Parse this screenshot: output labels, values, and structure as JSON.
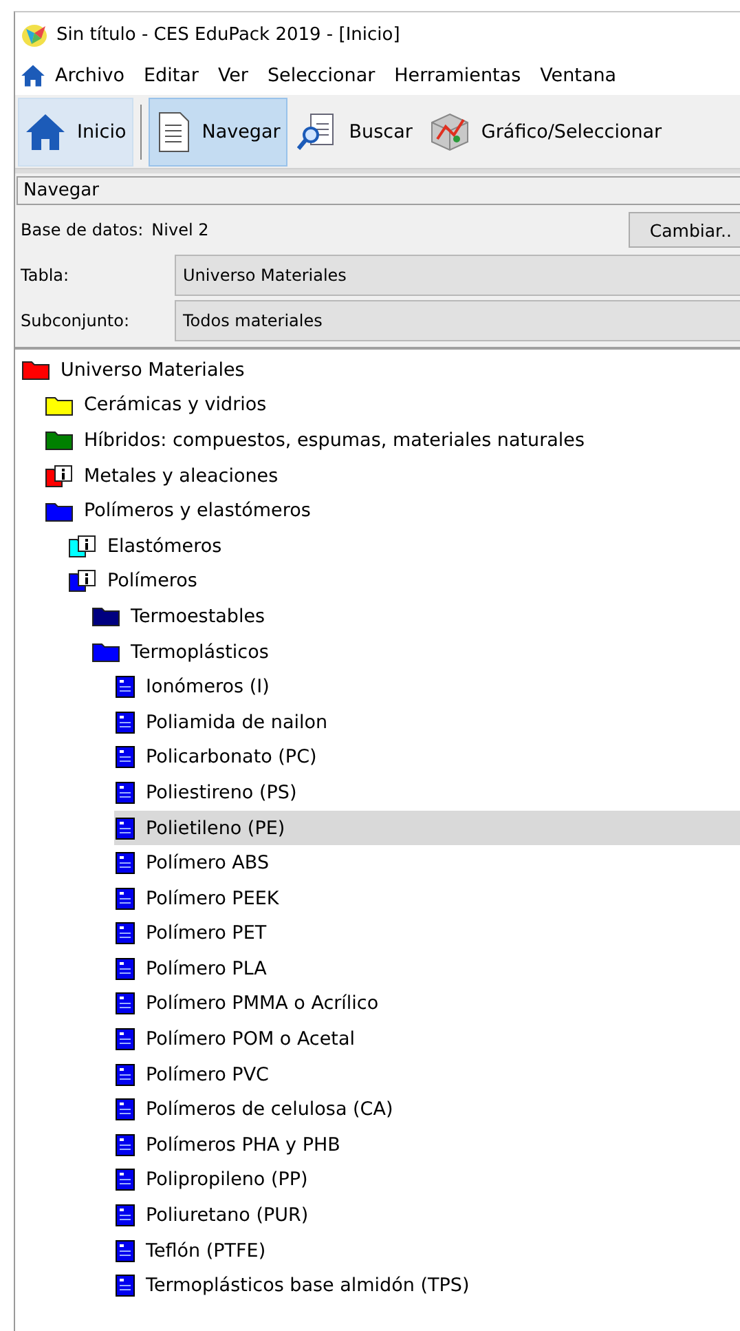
{
  "window": {
    "title": "Sin título - CES EduPack 2019 - [Inicio]"
  },
  "menu": [
    "Archivo",
    "Editar",
    "Ver",
    "Seleccionar",
    "Herramientas",
    "Ventana"
  ],
  "toolbar": [
    {
      "label": "Inicio",
      "kind": "home",
      "selected": false,
      "hover": true
    },
    {
      "label": "Navegar",
      "kind": "document",
      "selected": true,
      "hover": false
    },
    {
      "label": "Buscar",
      "kind": "search",
      "selected": false,
      "hover": false
    },
    {
      "label": "Gráfico/Seleccionar",
      "kind": "cube",
      "selected": false,
      "hover": false
    }
  ],
  "panel": {
    "title": "Navegar",
    "database_label": "Base de datos:",
    "database_value": "Nivel 2",
    "change_button": "Cambiar..",
    "table_label": "Tabla:",
    "table_value": "Universo Materiales",
    "subset_label": "Subconjunto:",
    "subset_value": "Todos materiales"
  },
  "tree": [
    {
      "label": "Universo Materiales",
      "kind": "folder",
      "color": "#ff0000",
      "selected": false,
      "children": [
        {
          "label": "Cerámicas y vidrios",
          "kind": "folder",
          "color": "#ffff00",
          "selected": false
        },
        {
          "label": "Híbridos: compuestos, espumas, materiales naturales",
          "kind": "folder",
          "color": "#008000",
          "selected": false
        },
        {
          "label": "Metales y aleaciones",
          "kind": "info",
          "color": "#ff0000",
          "selected": false
        },
        {
          "label": "Polímeros y elastómeros",
          "kind": "folder",
          "color": "#0000ff",
          "selected": false,
          "children": [
            {
              "label": "Elastómeros",
              "kind": "info",
              "color": "#00ffff",
              "selected": false
            },
            {
              "label": "Polímeros",
              "kind": "info",
              "color": "#0000ff",
              "selected": false,
              "children": [
                {
                  "label": "Termoestables",
                  "kind": "folder",
                  "color": "#000080",
                  "selected": false
                },
                {
                  "label": "Termoplásticos",
                  "kind": "folder",
                  "color": "#0000ff",
                  "selected": false,
                  "children": [
                    {
                      "label": "Ionómeros (I)",
                      "kind": "record",
                      "selected": false
                    },
                    {
                      "label": "Poliamida de nailon",
                      "kind": "record",
                      "selected": false
                    },
                    {
                      "label": "Policarbonato (PC)",
                      "kind": "record",
                      "selected": false
                    },
                    {
                      "label": "Poliestireno (PS)",
                      "kind": "record",
                      "selected": false
                    },
                    {
                      "label": "Polietileno (PE)",
                      "kind": "record",
                      "selected": true
                    },
                    {
                      "label": "Polímero ABS",
                      "kind": "record",
                      "selected": false
                    },
                    {
                      "label": "Polímero PEEK",
                      "kind": "record",
                      "selected": false
                    },
                    {
                      "label": "Polímero PET",
                      "kind": "record",
                      "selected": false
                    },
                    {
                      "label": "Polímero PLA",
                      "kind": "record",
                      "selected": false
                    },
                    {
                      "label": "Polímero PMMA o Acrílico",
                      "kind": "record",
                      "selected": false
                    },
                    {
                      "label": "Polímero POM o Acetal",
                      "kind": "record",
                      "selected": false
                    },
                    {
                      "label": "Polímero PVC",
                      "kind": "record",
                      "selected": false
                    },
                    {
                      "label": "Polímeros de celulosa (CA)",
                      "kind": "record",
                      "selected": false
                    },
                    {
                      "label": "Polímeros PHA y PHB",
                      "kind": "record",
                      "selected": false
                    },
                    {
                      "label": "Polipropileno (PP)",
                      "kind": "record",
                      "selected": false
                    },
                    {
                      "label": "Poliuretano (PUR)",
                      "kind": "record",
                      "selected": false
                    },
                    {
                      "label": "Teflón (PTFE)",
                      "kind": "record",
                      "selected": false
                    },
                    {
                      "label": "Termoplásticos base almidón (TPS)",
                      "kind": "record",
                      "selected": false
                    }
                  ]
                }
              ]
            }
          ]
        }
      ]
    }
  ]
}
